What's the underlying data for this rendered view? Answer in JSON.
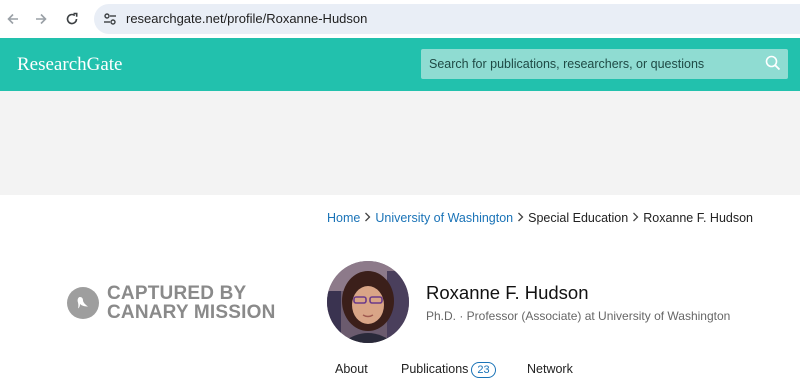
{
  "browser": {
    "url": "researchgate.net/profile/Roxanne-Hudson",
    "back_icon": "arrow-left-icon",
    "forward_icon": "arrow-right-icon",
    "reload_icon": "reload-icon",
    "site_info_icon": "tune-icon"
  },
  "header": {
    "logo": "ResearchGate",
    "search_placeholder": "Search for publications, researchers, or questions",
    "brand_color": "#22c1ad"
  },
  "breadcrumb": {
    "items": [
      "Home",
      "University of Washington",
      "Special Education",
      "Roxanne F. Hudson"
    ]
  },
  "watermark": {
    "line1": "CAPTURED BY",
    "line2": "CANARY MISSION"
  },
  "profile": {
    "name": "Roxanne F. Hudson",
    "subtitle": "Ph.D. · Professor (Associate) at University of Washington"
  },
  "tabs": {
    "about": "About",
    "publications": "Publications",
    "publications_count": "23",
    "network": "Network"
  }
}
